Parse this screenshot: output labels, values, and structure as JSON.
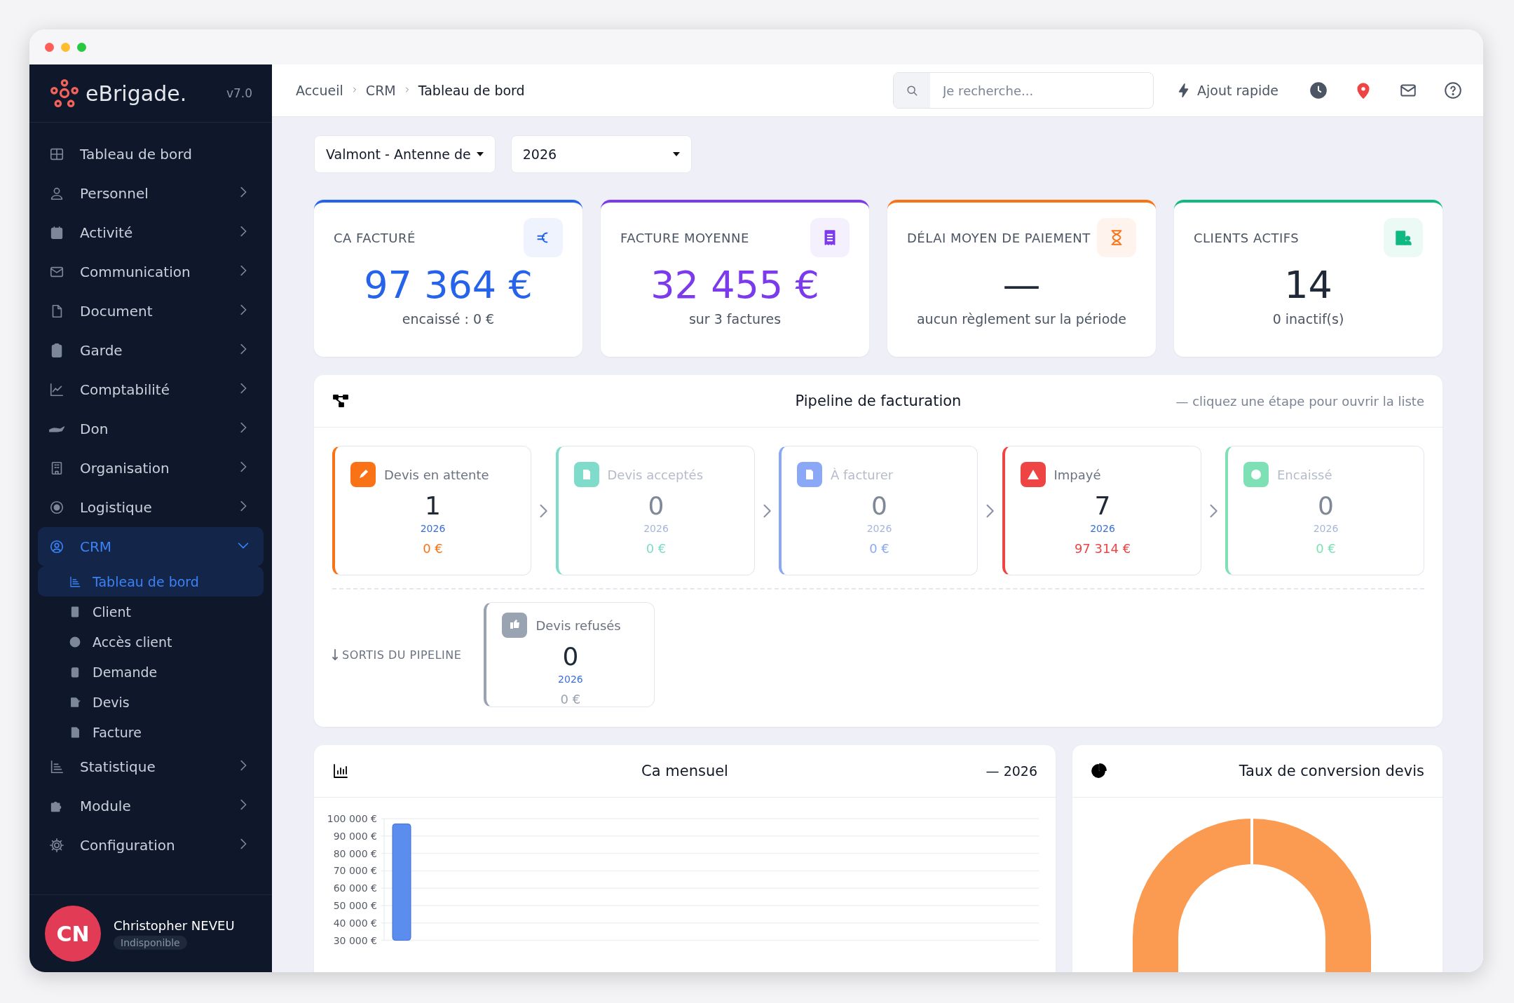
{
  "sidebar": {
    "logo": "eBrigade.",
    "version": "v7.0",
    "items": [
      {
        "label": "Tableau de bord",
        "kind": "link",
        "selected": false
      },
      {
        "label": "Personnel",
        "kind": "group",
        "expanded": false,
        "selected": false
      },
      {
        "label": "Activité",
        "kind": "group",
        "expanded": false,
        "selected": false
      },
      {
        "label": "Communication",
        "kind": "group",
        "expanded": false,
        "selected": false
      },
      {
        "label": "Document",
        "kind": "group",
        "expanded": false,
        "selected": false
      },
      {
        "label": "Garde",
        "kind": "group",
        "expanded": false,
        "selected": false
      },
      {
        "label": "Comptabilité",
        "kind": "group",
        "expanded": false,
        "selected": false
      },
      {
        "label": "Don",
        "kind": "group",
        "expanded": false,
        "selected": false
      },
      {
        "label": "Organisation",
        "kind": "group",
        "expanded": false,
        "selected": false
      },
      {
        "label": "Logistique",
        "kind": "group",
        "expanded": false,
        "selected": false
      },
      {
        "label": "CRM",
        "kind": "group",
        "expanded": true,
        "selected": true,
        "children": [
          {
            "label": "Tableau de bord",
            "selected": true
          },
          {
            "label": "Client",
            "selected": false
          },
          {
            "label": "Accès client",
            "selected": false
          },
          {
            "label": "Demande",
            "selected": false
          },
          {
            "label": "Devis",
            "selected": false
          },
          {
            "label": "Facture",
            "selected": false
          }
        ]
      },
      {
        "label": "Statistique",
        "kind": "group",
        "expanded": false,
        "selected": false
      },
      {
        "label": "Module",
        "kind": "group",
        "expanded": false,
        "selected": false
      },
      {
        "label": "Configuration",
        "kind": "group",
        "expanded": false,
        "selected": false
      }
    ],
    "user": {
      "initials": "CN",
      "name": "Christopher NEVEU",
      "status": "Indisponible"
    }
  },
  "topbar": {
    "breadcrumb": [
      "Accueil",
      "CRM",
      "Tableau de bord"
    ],
    "search": {
      "placeholder": "Je recherche..."
    },
    "quick_add": "Ajout rapide"
  },
  "filters": [
    {
      "value": "Valmont - Antenne de"
    },
    {
      "value": "2026"
    }
  ],
  "kpis": [
    {
      "title": "CA FACTURÉ",
      "value": "97 364 €",
      "subtitle": "encaissé : 0 €",
      "color": "#2563eb"
    },
    {
      "title": "FACTURE MOYENNE",
      "value": "32 455 €",
      "subtitle": "sur 3 factures",
      "color": "#7c3aed"
    },
    {
      "title": "DÉLAI MOYEN DE PAIEMENT",
      "value": "—",
      "subtitle": "aucun règlement sur la période",
      "color": "#f97316"
    },
    {
      "title": "CLIENTS ACTIFS",
      "value": "14",
      "subtitle": "0 inactif(s)",
      "color": "#10b981"
    }
  ],
  "pipeline": {
    "title": "Pipeline de facturation",
    "hint": "— cliquez une étape pour ouvrir la liste",
    "stages": [
      {
        "label": "Devis en attente",
        "count": "1",
        "year": "2026",
        "amount": "0 €",
        "color": "#f97316",
        "muted": false
      },
      {
        "label": "Devis acceptés",
        "count": "0",
        "year": "2026",
        "amount": "0 €",
        "color": "#7fdccb",
        "muted": true
      },
      {
        "label": "À facturer",
        "count": "0",
        "year": "2026",
        "amount": "0 €",
        "color": "#8aa8f5",
        "muted": true
      },
      {
        "label": "Impayé",
        "count": "7",
        "year": "2026",
        "amount": "97 314 €",
        "color": "#ef4444",
        "muted": false
      },
      {
        "label": "Encaissé",
        "count": "0",
        "year": "2026",
        "amount": "0 €",
        "color": "#7ee0b5",
        "muted": true
      }
    ],
    "exits_label": "SORTIS DU PIPELINE",
    "exits": [
      {
        "label": "Devis refusés",
        "count": "0",
        "year": "2026",
        "amount": "0 €",
        "color": "#9aa3b2",
        "muted": false
      }
    ]
  },
  "monthly": {
    "title": "Ca mensuel",
    "period": "— 2026",
    "chart_data": {
      "type": "bar",
      "ylim": [
        30000,
        100000
      ],
      "grid": true,
      "series": [
        {
          "color": "#5b8def",
          "values": [
            97000
          ]
        }
      ],
      "yticks": [
        {
          "value": 100000,
          "label": "100 000 €"
        },
        {
          "value": 90000,
          "label": "90 000 €"
        },
        {
          "value": 80000,
          "label": "80 000 €"
        },
        {
          "value": 70000,
          "label": "70 000 €"
        },
        {
          "value": 60000,
          "label": "60 000 €"
        },
        {
          "value": 50000,
          "label": "50 000 €"
        },
        {
          "value": 40000,
          "label": "40 000 €"
        },
        {
          "value": 30000,
          "label": "30 000 €"
        }
      ]
    }
  },
  "conversion": {
    "title": "Taux de conversion devis"
  }
}
